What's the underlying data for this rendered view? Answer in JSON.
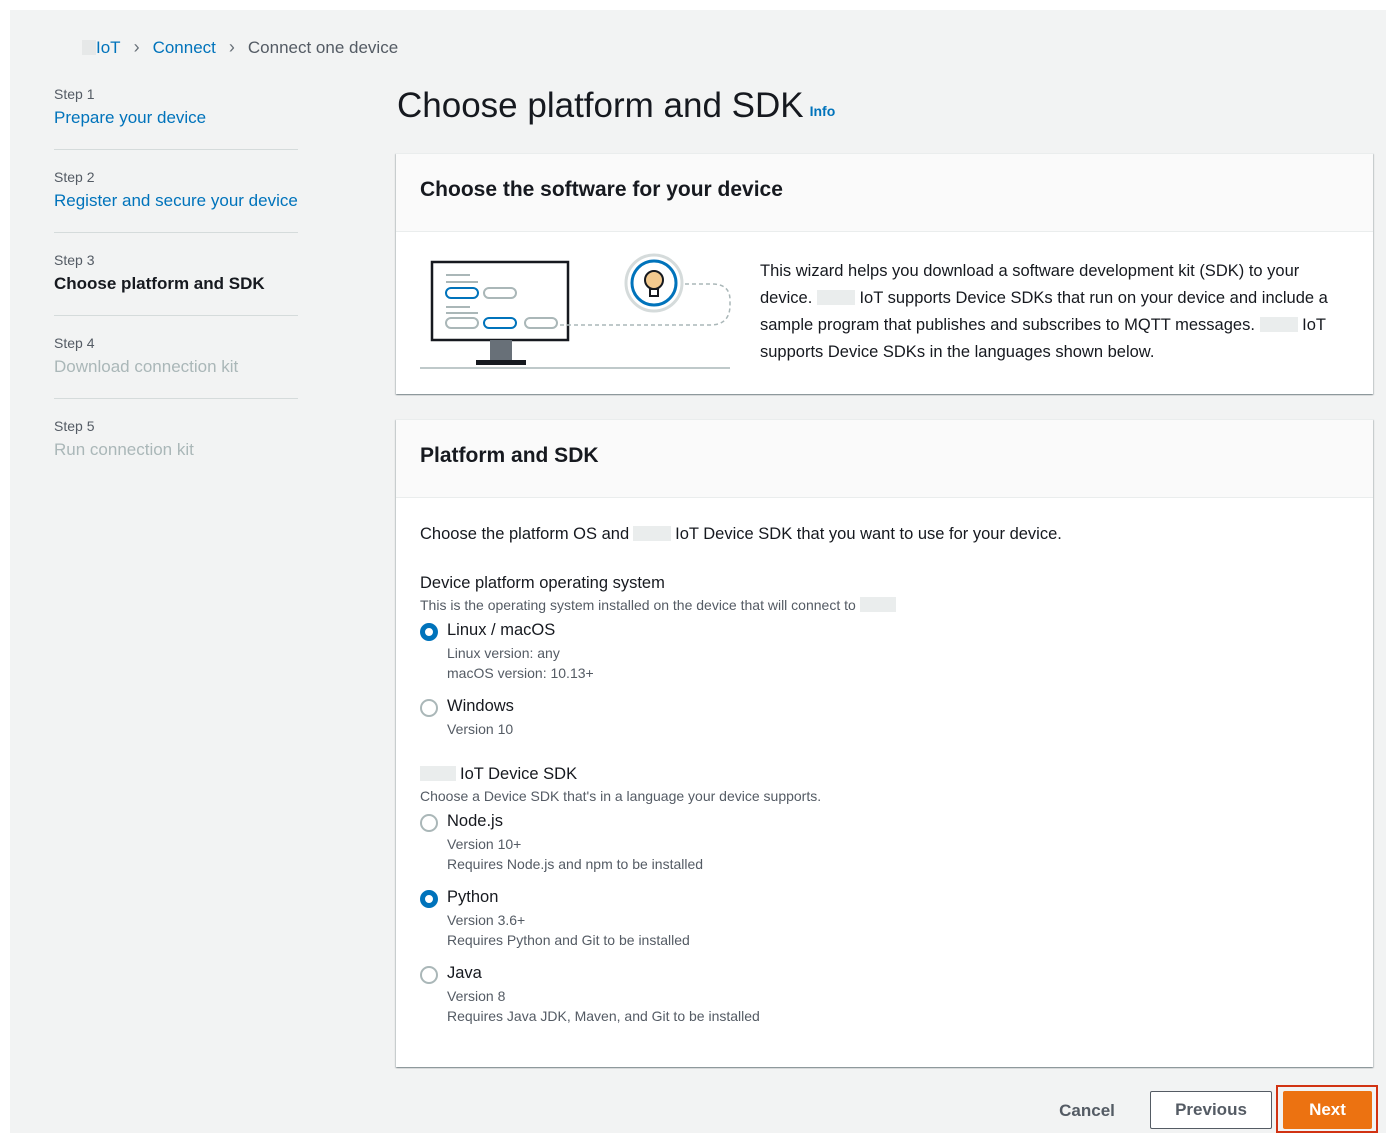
{
  "breadcrumb": {
    "items": [
      "IoT",
      "Connect"
    ],
    "current": "Connect one device"
  },
  "steps": [
    {
      "num": "Step 1",
      "label": "Prepare your device"
    },
    {
      "num": "Step 2",
      "label": "Register and secure your device"
    },
    {
      "num": "Step 3",
      "label": "Choose platform and SDK"
    },
    {
      "num": "Step 4",
      "label": "Download connection kit"
    },
    {
      "num": "Step 5",
      "label": "Run connection kit"
    }
  ],
  "page": {
    "title": "Choose platform and SDK",
    "info": "Info"
  },
  "software_panel": {
    "title": "Choose the software for your device",
    "text_1": "This wizard helps you download a software development kit (SDK) to your device.",
    "text_2": "IoT supports Device SDKs that run on your device and include a sample program that publishes and subscribes to MQTT messages.",
    "text_3": "IoT supports Device SDKs in the languages shown below."
  },
  "platform_panel": {
    "title": "Platform and SDK",
    "desc_1": "Choose the platform OS and",
    "desc_2": "IoT Device SDK that you want to use for your device.",
    "os_group": {
      "label": "Device platform operating system",
      "desc": "This is the operating system installed on the device that will connect to",
      "options": [
        {
          "label": "Linux / macOS",
          "line1": "Linux version: any",
          "line2": "macOS version: 10.13+",
          "checked": true
        },
        {
          "label": "Windows",
          "line1": "Version 10",
          "line2": "",
          "checked": false
        }
      ]
    },
    "sdk_group": {
      "label": "IoT Device SDK",
      "desc": "Choose a Device SDK that's in a language your device supports.",
      "options": [
        {
          "label": "Node.js",
          "line1": "Version 10+",
          "line2": "Requires Node.js and npm to be installed",
          "checked": false
        },
        {
          "label": "Python",
          "line1": "Version 3.6+",
          "line2": "Requires Python and Git to be installed",
          "checked": true
        },
        {
          "label": "Java",
          "line1": "Version 8",
          "line2": "Requires Java JDK, Maven, and Git to be installed",
          "checked": false
        }
      ]
    }
  },
  "footer": {
    "cancel": "Cancel",
    "previous": "Previous",
    "next": "Next"
  },
  "colors": {
    "link": "#0073bb",
    "primary": "#ec7211",
    "highlight": "#d13212"
  }
}
